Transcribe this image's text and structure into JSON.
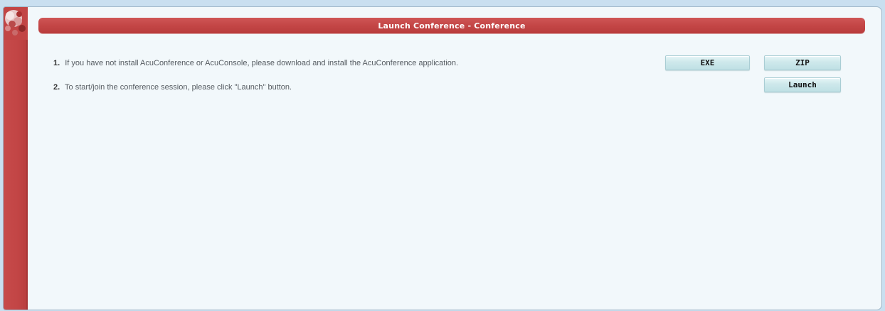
{
  "header": {
    "title": "Launch Conference - Conference"
  },
  "steps": [
    {
      "number": "1.",
      "text": "If you have not install AcuConference or AcuConsole, please download and install the AcuConference application."
    },
    {
      "number": "2.",
      "text": "To start/join the conference session, please click \"Launch\" button."
    }
  ],
  "buttons": {
    "exe": "EXE",
    "zip": "ZIP",
    "launch": "Launch"
  },
  "colors": {
    "accent_red": "#c44646",
    "panel_bg": "#f2f8fb",
    "button_bg": "#cfe9ec"
  },
  "icons": {
    "logo": "flower-logo-icon"
  }
}
